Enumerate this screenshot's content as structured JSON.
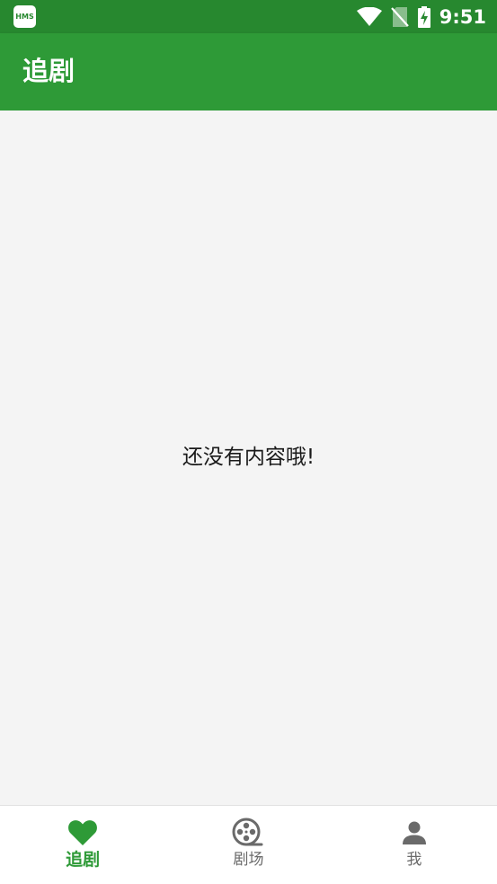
{
  "status_bar": {
    "badge_text": "HMS",
    "time": "9:51",
    "icons": [
      "hms-icon",
      "wifi-icon",
      "no-sim-icon",
      "battery-charging-icon"
    ]
  },
  "app_bar": {
    "title": "追剧"
  },
  "content": {
    "empty_message": "还没有内容哦!"
  },
  "bottom_nav": {
    "items": [
      {
        "label": "追剧",
        "icon": "heart-icon",
        "active": true
      },
      {
        "label": "剧场",
        "icon": "film-reel-icon",
        "active": false
      },
      {
        "label": "我",
        "icon": "person-icon",
        "active": false
      }
    ]
  },
  "colors": {
    "status_bar": "#27882f",
    "primary": "#2e9a37",
    "background": "#f4f4f4",
    "inactive": "#6a6a6a"
  }
}
